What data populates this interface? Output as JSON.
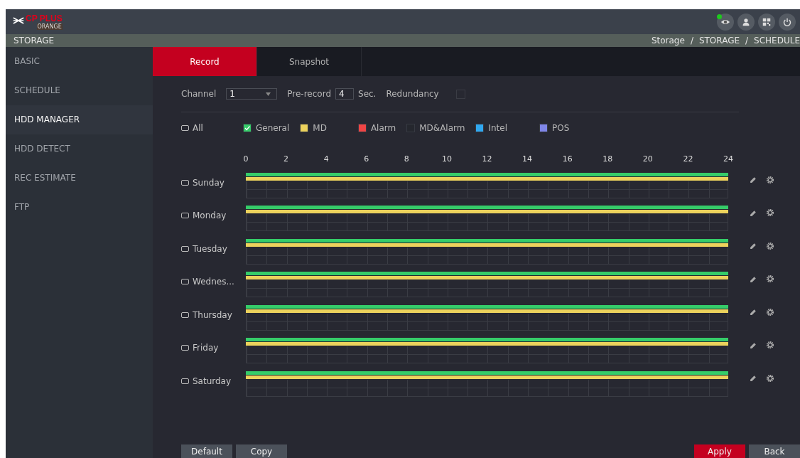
{
  "header": {
    "logo": "CP PLUS",
    "logo_sub": "ORANGE",
    "icons": [
      {
        "kind": "eye",
        "alert": true
      },
      {
        "kind": "user",
        "alert": false
      },
      {
        "kind": "qr",
        "alert": false
      },
      {
        "kind": "power",
        "alert": false
      }
    ]
  },
  "title_bar": {
    "title": "STORAGE",
    "breadcrumb": [
      "Storage",
      "/",
      "STORAGE",
      "/",
      "SCHEDULE"
    ]
  },
  "sidebar": {
    "items": [
      {
        "label": "BASIC",
        "selected": false
      },
      {
        "label": "SCHEDULE",
        "selected": false
      },
      {
        "label": "HDD MANAGER",
        "selected": true
      },
      {
        "label": "HDD DETECT",
        "selected": false
      },
      {
        "label": "REC ESTIMATE",
        "selected": false
      },
      {
        "label": "FTP",
        "selected": false
      }
    ]
  },
  "tabs": [
    {
      "label": "Record",
      "selected": true
    },
    {
      "label": "Snapshot",
      "selected": false
    }
  ],
  "settings": {
    "channel_label": "Channel",
    "channel": "1",
    "prerecord_label": "Pre-record",
    "prerecord": "4",
    "sec_label": "Sec.",
    "redundancy_label": "Redundancy",
    "redundancy": false
  },
  "all": {
    "label": "All",
    "checked": false
  },
  "legend": [
    {
      "label": "General",
      "color": "#35cc69",
      "checked": true
    },
    {
      "label": "MD",
      "color": "#ecd25c",
      "checked": false
    },
    {
      "label": "Alarm",
      "color": "#f04545",
      "checked": false
    },
    {
      "label": "MD&Alarm",
      "color": "#25272e",
      "checked": false
    },
    {
      "label": "Intel",
      "color": "#30a8f0",
      "checked": false
    },
    {
      "label": "POS",
      "color": "#7f86e8",
      "checked": false
    }
  ],
  "hours": [
    "0",
    "2",
    "4",
    "6",
    "8",
    "10",
    "12",
    "14",
    "16",
    "18",
    "20",
    "22",
    "24"
  ],
  "days": [
    {
      "label": "Sunday",
      "checked": false,
      "bars": [
        {
          "color": "#35cc69"
        },
        {
          "color": "#ecd25c"
        }
      ]
    },
    {
      "label": "Monday",
      "checked": false,
      "bars": [
        {
          "color": "#35cc69"
        },
        {
          "color": "#ecd25c"
        }
      ]
    },
    {
      "label": "Tuesday",
      "checked": false,
      "bars": [
        {
          "color": "#35cc69"
        },
        {
          "color": "#ecd25c"
        }
      ]
    },
    {
      "label": "Wednes...",
      "checked": false,
      "bars": [
        {
          "color": "#35cc69"
        },
        {
          "color": "#ecd25c"
        }
      ]
    },
    {
      "label": "Thursday",
      "checked": false,
      "bars": [
        {
          "color": "#35cc69"
        },
        {
          "color": "#ecd25c"
        }
      ]
    },
    {
      "label": "Friday",
      "checked": false,
      "bars": [
        {
          "color": "#35cc69"
        },
        {
          "color": "#ecd25c"
        }
      ]
    },
    {
      "label": "Saturday",
      "checked": false,
      "bars": [
        {
          "color": "#35cc69"
        },
        {
          "color": "#ecd25c"
        }
      ]
    }
  ],
  "buttons_left": [
    {
      "label": "Default",
      "kind": "normal"
    },
    {
      "label": "Copy",
      "kind": "normal"
    }
  ],
  "buttons_right": [
    {
      "label": "Apply",
      "kind": "primary"
    },
    {
      "label": "Back",
      "kind": "normal"
    }
  ]
}
